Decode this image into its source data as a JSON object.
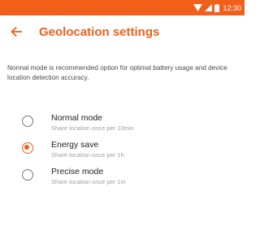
{
  "status_bar": {
    "time": "12:30",
    "background_color": "#f0601b",
    "icons": [
      "wifi-icon",
      "signal-icon",
      "battery-icon"
    ]
  },
  "toolbar": {
    "back_icon": "arrow-left-icon",
    "title": "Geolocation settings",
    "accent_color": "#f0601b"
  },
  "description": "Normal mode is recommended option for optimal battery usage and device location detection accuracy.",
  "options": [
    {
      "title": "Normal mode",
      "subtitle": "Share location once per 10min",
      "selected": false
    },
    {
      "title": "Energy save",
      "subtitle": "Share location once per 1h",
      "selected": true
    },
    {
      "title": "Precise mode",
      "subtitle": "Share location once per 1m",
      "selected": false
    }
  ]
}
